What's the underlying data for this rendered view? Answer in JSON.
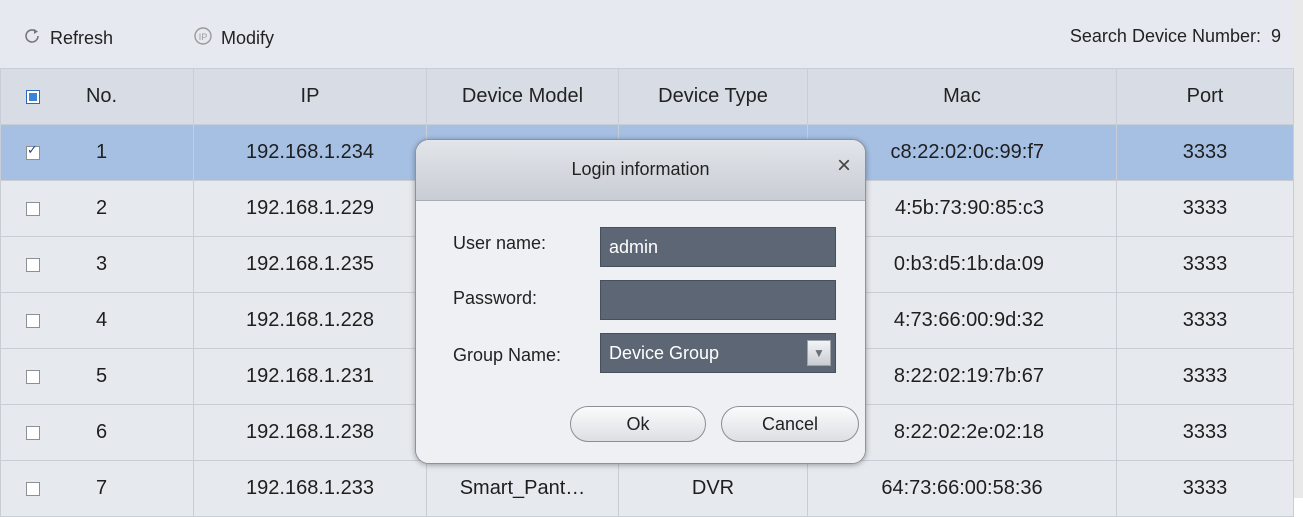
{
  "toolbar": {
    "refresh_label": "Refresh",
    "modify_label": "Modify",
    "modify_icon_text": "IP",
    "count_label": "Search Device Number:",
    "count_value": "9"
  },
  "table": {
    "headers": [
      "No.",
      "IP",
      "Device Model",
      "Device Type",
      "Mac",
      "Port"
    ],
    "rows": [
      {
        "no": "1",
        "ip": "192.168.1.234",
        "mac": "c8:22:02:0c:99:f7",
        "port": "3333",
        "checked": true
      },
      {
        "no": "2",
        "ip": "192.168.1.229",
        "mac": "4:5b:73:90:85:c3",
        "port": "3333",
        "checked": false
      },
      {
        "no": "3",
        "ip": "192.168.1.235",
        "mac": "0:b3:d5:1b:da:09",
        "port": "3333",
        "checked": false
      },
      {
        "no": "4",
        "ip": "192.168.1.228",
        "mac": "4:73:66:00:9d:32",
        "port": "3333",
        "checked": false
      },
      {
        "no": "5",
        "ip": "192.168.1.231",
        "mac": "8:22:02:19:7b:67",
        "port": "3333",
        "checked": false
      },
      {
        "no": "6",
        "ip": "192.168.1.238",
        "mac": "8:22:02:2e:02:18",
        "port": "3333",
        "checked": false
      },
      {
        "no": "7",
        "ip": "192.168.1.233",
        "model": "Smart_Pant…",
        "type": "DVR",
        "mac": "64:73:66:00:58:36",
        "port": "3333",
        "checked": false
      }
    ]
  },
  "dialog": {
    "title": "Login information",
    "close_glyph": "×",
    "username_label": "User name:",
    "username_value": "admin",
    "password_label": "Password:",
    "password_value": "",
    "group_label": "Group Name:",
    "group_value": "Device Group",
    "ok_label": "Ok",
    "cancel_label": "Cancel"
  },
  "colors": {
    "selected_row": "#a6c0e4",
    "field_bg": "#5d6674",
    "header_bg": "#d8dde5"
  }
}
